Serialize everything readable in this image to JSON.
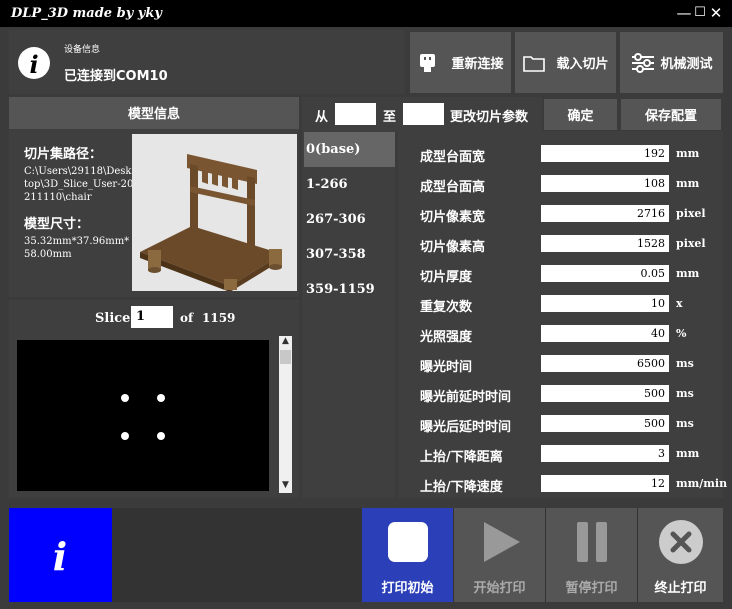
{
  "window": {
    "title": "DLP_3D made by yky"
  },
  "device": {
    "caption": "设备信息",
    "status": "已连接到COM10"
  },
  "toolbar": {
    "reconnect": "重新连接",
    "load_slices": "载入切片",
    "mech_test": "机械测试"
  },
  "model_info": {
    "header": "模型信息",
    "path_label": "切片集路径：",
    "path_value": "C:\\Users\\29118\\Desktop\\3D_Slice_User-20211110\\chair",
    "size_label": "模型尺寸：",
    "size_value": "35.32mm*37.96mm*58.00mm"
  },
  "slice": {
    "label": "Slice",
    "value": "1",
    "of_label": "of",
    "total": "1159"
  },
  "range": {
    "from_label": "从",
    "from_value": "",
    "to_label": "至",
    "to_value": "",
    "edit_label": "更改切片参数",
    "confirm": "确定",
    "save_config": "保存配置"
  },
  "ranges": [
    "0(base)",
    "1-266",
    "267-306",
    "307-358",
    "359-1159"
  ],
  "params": [
    {
      "label": "成型台面宽",
      "value": "192",
      "unit": "mm"
    },
    {
      "label": "成型台面高",
      "value": "108",
      "unit": "mm"
    },
    {
      "label": "切片像素宽",
      "value": "2716",
      "unit": "pixel"
    },
    {
      "label": "切片像素高",
      "value": "1528",
      "unit": "pixel"
    },
    {
      "label": "切片厚度",
      "value": "0.05",
      "unit": "mm"
    },
    {
      "label": "重复次数",
      "value": "10",
      "unit": "x"
    },
    {
      "label": "光照强度",
      "value": "40",
      "unit": "%"
    },
    {
      "label": "曝光时间",
      "value": "6500",
      "unit": "ms"
    },
    {
      "label": "曝光前延时时间",
      "value": "500",
      "unit": "ms"
    },
    {
      "label": "曝光后延时时间",
      "value": "500",
      "unit": "ms"
    },
    {
      "label": "上抬/下降距离",
      "value": "3",
      "unit": "mm"
    },
    {
      "label": "上抬/下降速度",
      "value": "12",
      "unit": "mm/min"
    }
  ],
  "bottom": {
    "print_init": "打印初始",
    "start_print": "开始打印",
    "pause_print": "暂停打印",
    "stop_print": "终止打印"
  },
  "colors": {
    "info_blue": "#0000ff",
    "init_blue": "#2a3fb8",
    "panel": "#444444"
  }
}
